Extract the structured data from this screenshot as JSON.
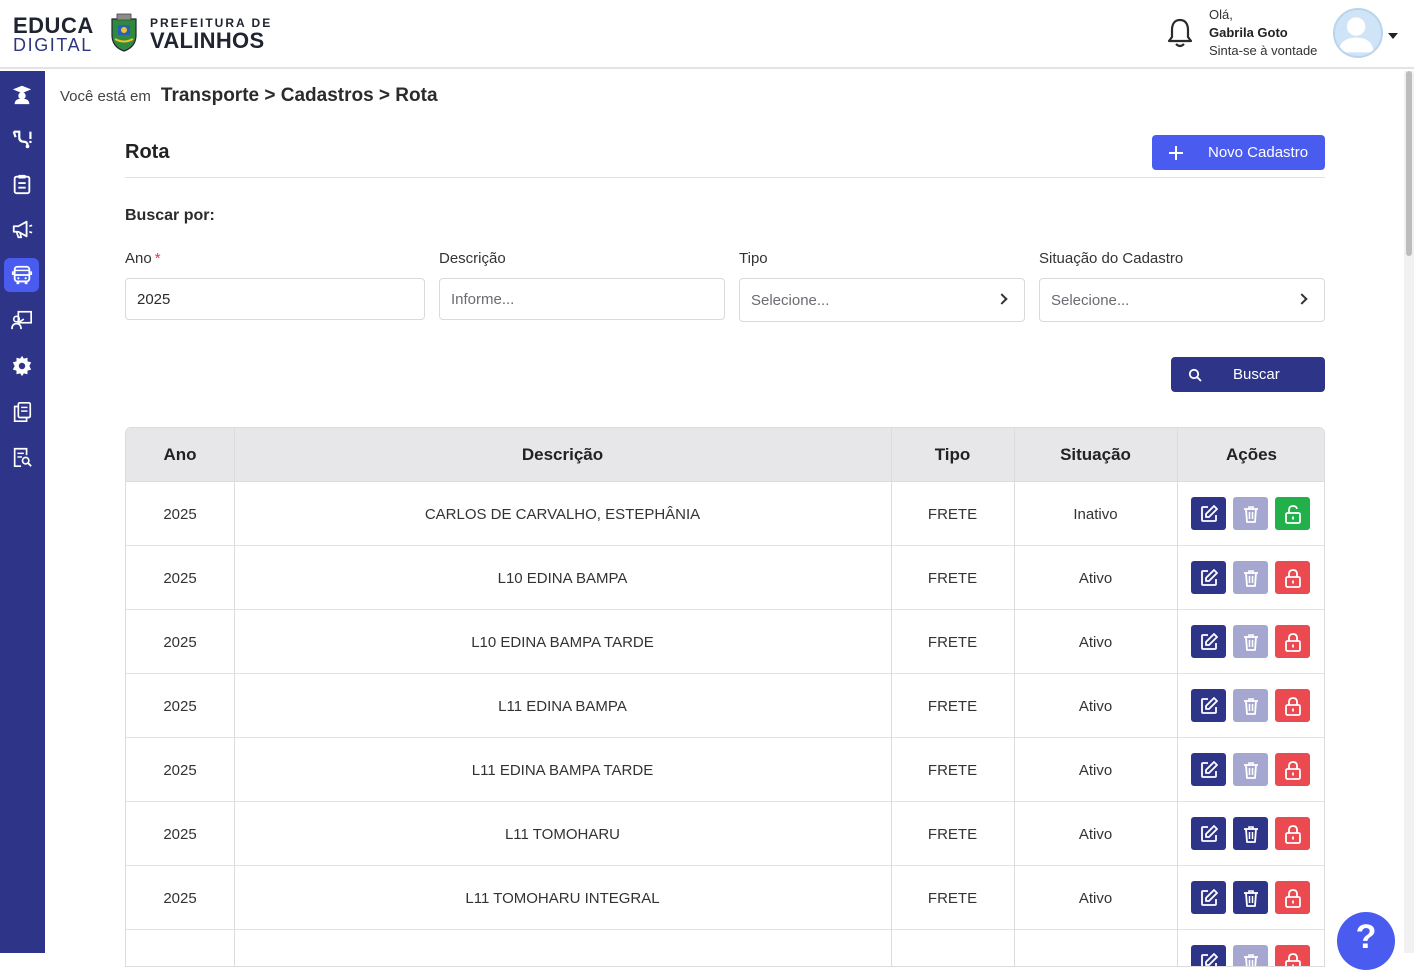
{
  "header": {
    "logo_line1": "EDUCA",
    "logo_line2": "DIGITAL",
    "pref_line1": "PREFEITURA DE",
    "pref_line2": "VALINHOS",
    "greeting": "Olá,",
    "user_name": "Gabrila Goto",
    "user_sub": "Sinta-se à vontade"
  },
  "sidebar": {
    "items": [
      {
        "icon": "graduation-icon",
        "active": false
      },
      {
        "icon": "stethoscope-icon",
        "active": false
      },
      {
        "icon": "clipboard-icon",
        "active": false
      },
      {
        "icon": "megaphone-icon",
        "active": false
      },
      {
        "icon": "bus-icon",
        "active": true
      },
      {
        "icon": "teacher-board-icon",
        "active": false
      },
      {
        "icon": "gear-icon",
        "active": false
      },
      {
        "icon": "documents-icon",
        "active": false
      },
      {
        "icon": "document-search-icon",
        "active": false
      }
    ]
  },
  "breadcrumb": {
    "prefix": "Você está em",
    "path": "Transporte > Cadastros > Rota"
  },
  "page": {
    "title": "Rota",
    "new_button": "Novo Cadastro",
    "search_by": "Buscar por:",
    "search_button": "Buscar"
  },
  "filters": {
    "ano": {
      "label": "Ano",
      "required_mark": "*",
      "value": "2025"
    },
    "descricao": {
      "label": "Descrição",
      "placeholder": "Informe..."
    },
    "tipo": {
      "label": "Tipo",
      "value": "Selecione..."
    },
    "situacao": {
      "label": "Situação do Cadastro",
      "value": "Selecione..."
    }
  },
  "table": {
    "columns": [
      "Ano",
      "Descrição",
      "Tipo",
      "Situação",
      "Ações"
    ],
    "rows": [
      {
        "ano": "2025",
        "descricao": "CARLOS DE CARVALHO, ESTEPHÂNIA",
        "tipo": "FRETE",
        "situacao": "Inativo",
        "delete_enabled": false,
        "lock": "green"
      },
      {
        "ano": "2025",
        "descricao": "L10 EDINA BAMPA",
        "tipo": "FRETE",
        "situacao": "Ativo",
        "delete_enabled": false,
        "lock": "red"
      },
      {
        "ano": "2025",
        "descricao": "L10 EDINA BAMPA TARDE",
        "tipo": "FRETE",
        "situacao": "Ativo",
        "delete_enabled": false,
        "lock": "red"
      },
      {
        "ano": "2025",
        "descricao": "L11 EDINA BAMPA",
        "tipo": "FRETE",
        "situacao": "Ativo",
        "delete_enabled": false,
        "lock": "red"
      },
      {
        "ano": "2025",
        "descricao": "L11 EDINA BAMPA TARDE",
        "tipo": "FRETE",
        "situacao": "Ativo",
        "delete_enabled": false,
        "lock": "red"
      },
      {
        "ano": "2025",
        "descricao": "L11 TOMOHARU",
        "tipo": "FRETE",
        "situacao": "Ativo",
        "delete_enabled": true,
        "lock": "red"
      },
      {
        "ano": "2025",
        "descricao": "L11 TOMOHARU INTEGRAL",
        "tipo": "FRETE",
        "situacao": "Ativo",
        "delete_enabled": true,
        "lock": "red"
      },
      {
        "ano": "",
        "descricao": "",
        "tipo": "",
        "situacao": "",
        "delete_enabled": false,
        "lock": "red"
      }
    ]
  },
  "help": {
    "label": "?"
  },
  "colors": {
    "sidebar": "#2e3589",
    "primary": "#4a5bf0",
    "dark_button": "#2e3589",
    "disabled": "#a6a7d0",
    "lock_open": "#22b04b",
    "lock_closed": "#ea4a50"
  }
}
